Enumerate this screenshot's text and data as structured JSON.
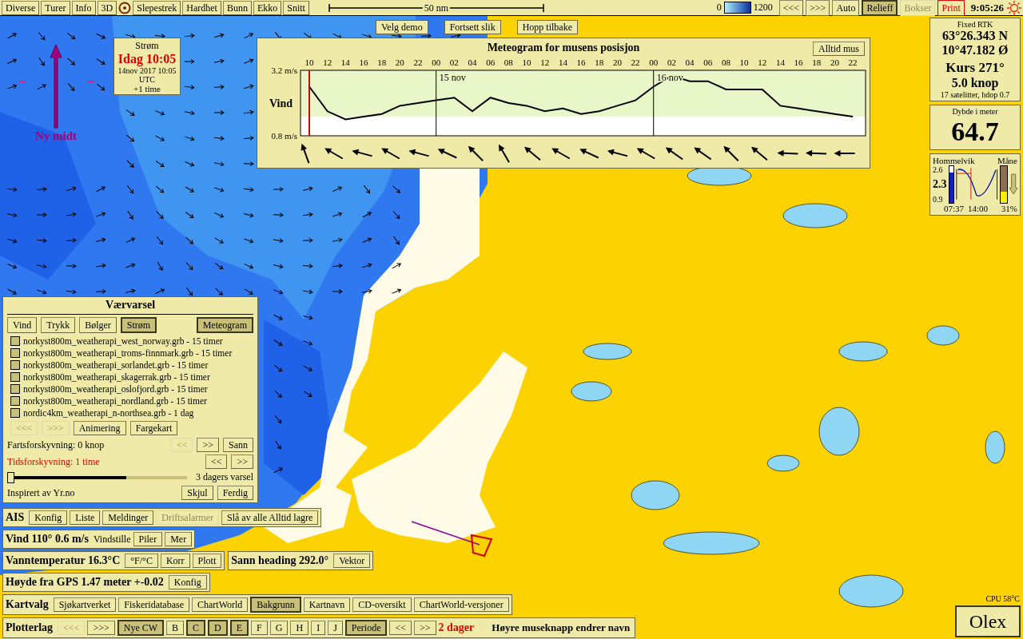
{
  "top_bar": {
    "menu": [
      {
        "kind": "button",
        "label": "Diverse"
      },
      {
        "kind": "button",
        "label": "Turer"
      },
      {
        "kind": "button",
        "label": "Info"
      },
      {
        "kind": "button",
        "label": "3D"
      },
      {
        "kind": "target"
      },
      {
        "kind": "button",
        "label": "Slepestrek"
      },
      {
        "kind": "button",
        "label": "Hardhet"
      },
      {
        "kind": "button",
        "label": "Bunn"
      },
      {
        "kind": "button",
        "label": "Ekko"
      },
      {
        "kind": "button",
        "label": "Snitt"
      }
    ],
    "scale_label": "50 nm",
    "depth_min": "0",
    "depth_max": "1200",
    "buttons": [
      {
        "label": "<<<",
        "selected": false,
        "disabled": false,
        "alert": false
      },
      {
        "label": ">>>",
        "selected": false,
        "disabled": false,
        "alert": false
      },
      {
        "label": "Auto",
        "selected": false,
        "disabled": false,
        "alert": false
      },
      {
        "label": "Relieff",
        "selected": true,
        "disabled": false,
        "alert": false
      },
      {
        "label": "Bokser",
        "selected": false,
        "disabled": true,
        "alert": false
      },
      {
        "label": "Print",
        "selected": false,
        "disabled": false,
        "alert": true
      }
    ],
    "clock": "9:05:26"
  },
  "map_buttons": [
    "Velg demo",
    "Fortsett slik",
    "Hopp tilbake"
  ],
  "current_box": {
    "title": "Strøm",
    "time": "Idag 10:05",
    "date": "14nov 2017 10:05 UTC",
    "offset": "+1 time"
  },
  "north_marker": {
    "label": "Ny midt"
  },
  "meteogram": {
    "title": "Meteogram for musens posisjon",
    "button": "Alltid mus",
    "chart_data": {
      "type": "line",
      "ylim": [
        0.8,
        3.2
      ],
      "categories": [
        "10",
        "12",
        "14",
        "16",
        "18",
        "20",
        "22",
        "00",
        "02",
        "04",
        "06",
        "08",
        "10",
        "12",
        "14",
        "16",
        "18",
        "20",
        "22",
        "00",
        "02",
        "04",
        "06",
        "08",
        "10",
        "12",
        "14",
        "16",
        "18",
        "20",
        "22"
      ],
      "yticks": [
        {
          "value": 3.2,
          "label": "3.2 m/s"
        },
        {
          "value": 0.8,
          "label": "0.8 m/s"
        }
      ],
      "series": [
        {
          "name": "Vind",
          "color": "#000000",
          "values": [
            2.6,
            1.7,
            1.4,
            1.5,
            1.6,
            1.9,
            2.0,
            2.1,
            2.2,
            1.7,
            2.2,
            2.0,
            1.9,
            1.7,
            1.8,
            1.6,
            1.7,
            1.9,
            2.1,
            2.6,
            3.0,
            2.8,
            2.8,
            2.5,
            2.5,
            2.5,
            1.9,
            1.8,
            1.7,
            1.6,
            1.5
          ]
        }
      ],
      "bands": [
        {
          "axis": "y",
          "from": 1.5,
          "to": 3.2,
          "color": "#e8f6c8"
        }
      ],
      "ref_lines": [
        {
          "axis": "x",
          "value": "10",
          "color": "#e00000"
        }
      ],
      "annotations": [
        "15 nov",
        "16 nov"
      ]
    }
  },
  "position": {
    "fix": "Fixed RTK",
    "lat": "63°26.343 N",
    "lon": "10°47.182 Ø",
    "course": "Kurs 271°",
    "speed": "5.0 knop",
    "satellites": "17 satelitter, hdop 0.7"
  },
  "depth": {
    "label": "Dybde i meter",
    "value": "64.7"
  },
  "tide": {
    "place": "Hommelvik",
    "moon_label": "Måne",
    "high": "2.6",
    "now": "2.3",
    "low": "0.9",
    "time_now": "07:37",
    "time_low": "14:00",
    "moon_pct": "31%",
    "tide_level": {
      "level": 0.82
    },
    "moon_level": {
      "level": 0.31
    }
  },
  "weather": {
    "title": "Værvarsel",
    "tabs": [
      {
        "label": "Vind",
        "selected": false
      },
      {
        "label": "Trykk",
        "selected": false
      },
      {
        "label": "Bølger",
        "selected": false
      },
      {
        "label": "Strøm",
        "selected": true
      }
    ],
    "meteogram_button": {
      "label": "Meteogram",
      "selected": true
    },
    "files": [
      {
        "label": "norkyst800m_weatherapi_west_norway.grb - 15 timer",
        "checked": false
      },
      {
        "label": "norkyst800m_weatherapi_troms-finnmark.grb - 15 timer",
        "checked": false
      },
      {
        "label": "norkyst800m_weatherapi_sorlandet.grb - 15 timer",
        "checked": false
      },
      {
        "label": "norkyst800m_weatherapi_skagerrak.grb - 15 timer",
        "checked": false
      },
      {
        "label": "norkyst800m_weatherapi_oslofjord.grb - 15 timer",
        "checked": false
      },
      {
        "label": "norkyst800m_weatherapi_nordland.grb - 15 timer",
        "checked": false
      },
      {
        "label": "nordic4km_weatherapi_n-northsea.grb - 1 dag",
        "checked": false
      }
    ],
    "nav_buttons": [
      {
        "label": "<<<",
        "disabled": true
      },
      {
        "label": ">>>",
        "disabled": true
      },
      {
        "label": "Animering",
        "disabled": false
      },
      {
        "label": "Fargekart",
        "disabled": false
      }
    ],
    "speed_label": "Fartsforskyvning: 0 knop",
    "speed_buttons": [
      {
        "label": "<<",
        "disabled": true
      },
      {
        "label": ">>",
        "disabled": false
      },
      {
        "label": "Sann",
        "disabled": false
      }
    ],
    "time_label": "Tidsforskyvning: 1 time",
    "time_buttons": [
      {
        "label": "<<",
        "disabled": false
      },
      {
        "label": ">>",
        "disabled": false
      }
    ],
    "slider": {
      "level": 0.66
    },
    "forecast_label": "3 dagers varsel",
    "credit": "Inspirert av Yr.no",
    "buttons": [
      "Skjul",
      "Ferdig"
    ]
  },
  "ais": {
    "title": "AIS",
    "buttons": [
      {
        "label": "Konfig",
        "disabled": false
      },
      {
        "label": "Liste",
        "disabled": false
      },
      {
        "label": "Meldinger",
        "disabled": false
      },
      {
        "label": "Driftsalarmer",
        "disabled": true
      },
      {
        "label": "Slå av alle Alltid lagre",
        "disabled": false
      }
    ]
  },
  "wind": {
    "title": "Vind 110° 0.6 m/s",
    "status": "Vindstille",
    "buttons": [
      "Piler",
      "Mer"
    ]
  },
  "water_temp": {
    "title": "Vanntemperatur 16.3°C",
    "buttons": [
      "°F/°C",
      "Korr",
      "Plott"
    ]
  },
  "heading": {
    "title": "Sann heading 292.0°",
    "buttons": [
      "Vektor"
    ]
  },
  "gps_height": {
    "title": "Høyde fra GPS 1.47 meter +-0.02",
    "buttons": [
      "Konfig"
    ]
  },
  "chart_select": {
    "title": "Kartvalg",
    "buttons": [
      {
        "label": "Sjøkartverket",
        "selected": false
      },
      {
        "label": "Fiskeridatabase",
        "selected": false
      },
      {
        "label": "ChartWorld",
        "selected": false
      },
      {
        "label": "Bakgrunn",
        "selected": true
      },
      {
        "label": "Kartnavn",
        "selected": false
      },
      {
        "label": "CD-oversikt",
        "selected": false
      },
      {
        "label": "ChartWorld-versjoner",
        "selected": false
      }
    ]
  },
  "plotter_layers": {
    "title": "Plotterlag",
    "buttons": [
      {
        "label": "<<<",
        "selected": false,
        "disabled": true
      },
      {
        "label": ">>>",
        "selected": false,
        "disabled": false
      },
      {
        "label": "Nye CW",
        "selected": true,
        "disabled": false
      },
      {
        "label": "B",
        "selected": false,
        "disabled": false
      },
      {
        "label": "C",
        "selected": true,
        "disabled": false
      },
      {
        "label": "D",
        "selected": true,
        "disabled": false
      },
      {
        "label": "E",
        "selected": true,
        "disabled": false
      },
      {
        "label": "F",
        "selected": false,
        "disabled": false
      },
      {
        "label": "G",
        "selected": false,
        "disabled": false
      },
      {
        "label": "H",
        "selected": false,
        "disabled": false
      },
      {
        "label": "I",
        "selected": false,
        "disabled": false
      },
      {
        "label": "J",
        "selected": false,
        "disabled": false
      },
      {
        "label": "Periode",
        "selected": true,
        "disabled": false
      },
      {
        "label": "<<",
        "selected": false,
        "disabled": false
      },
      {
        "label": ">>",
        "selected": false,
        "disabled": false
      }
    ],
    "period": "2 dager",
    "hint": "Høyre museknapp endrer navn"
  },
  "cpu": "CPU 58°C",
  "logo": "Olex"
}
